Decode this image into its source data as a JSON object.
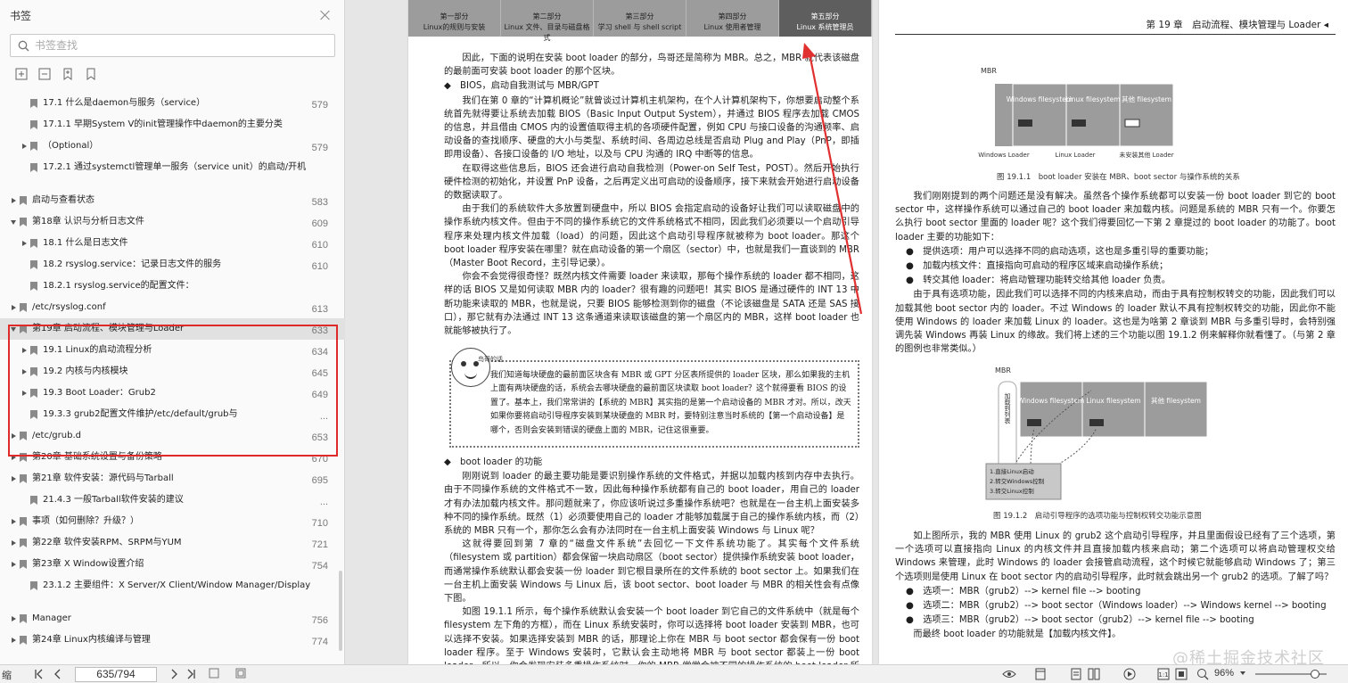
{
  "sidebar": {
    "title": "书签",
    "search_placeholder": "书签查找",
    "items": [
      {
        "label": "17.1 什么是daemon与服务（service）",
        "page": "579",
        "indent": 1,
        "chev": "none"
      },
      {
        "label": "17.1.1 早期System V的init管理操作中daemon的主要分类",
        "page": "",
        "indent": 1,
        "chev": "none"
      },
      {
        "label": "（Optional）",
        "page": "579",
        "indent": 1,
        "chev": "right"
      },
      {
        "label": "17.2.1 通过systemctl管理单一服务（service unit）的启动/开机",
        "page": "",
        "indent": 1,
        "chev": "none"
      },
      {
        "label": "启动与查看状态",
        "page": "583",
        "indent": 0,
        "chev": "right"
      },
      {
        "label": "第18章 认识与分析日志文件",
        "page": "609",
        "indent": 0,
        "chev": "down"
      },
      {
        "label": "18.1 什么是日志文件",
        "page": "610",
        "indent": 1,
        "chev": "right"
      },
      {
        "label": "18.2 rsyslog.service：记录日志文件的服务",
        "page": "610",
        "indent": 1,
        "chev": "none"
      },
      {
        "label": "18.2.1 rsyslog.service的配置文件：",
        "page": "",
        "indent": 1,
        "chev": "none"
      },
      {
        "label": "/etc/rsyslog.conf",
        "page": "613",
        "indent": 0,
        "chev": "right"
      },
      {
        "label": "第19章 启动流程、模块管理与Loader",
        "page": "633",
        "indent": 0,
        "chev": "down",
        "selected": true
      },
      {
        "label": "19.1 Linux的启动流程分析",
        "page": "634",
        "indent": 1,
        "chev": "right"
      },
      {
        "label": "19.2 内核与内核模块",
        "page": "645",
        "indent": 1,
        "chev": "right"
      },
      {
        "label": "19.3 Boot Loader：Grub2",
        "page": "649",
        "indent": 1,
        "chev": "right"
      },
      {
        "label": "19.3.3 grub2配置文件维护/etc/default/grub与",
        "page": "...",
        "indent": 1,
        "chev": "none"
      },
      {
        "label": "/etc/grub.d",
        "page": "653",
        "indent": 0,
        "chev": "right"
      },
      {
        "label": "第20章 基础系统设置与备份策略",
        "page": "670",
        "indent": 0,
        "chev": "right"
      },
      {
        "label": "第21章 软件安装：源代码与Tarball",
        "page": "695",
        "indent": 0,
        "chev": "right"
      },
      {
        "label": "21.4.3 一般Tarball软件安装的建议",
        "page": "...",
        "indent": 1,
        "chev": "none"
      },
      {
        "label": "事项（如何删除？升级？）",
        "page": "710",
        "indent": 0,
        "chev": "right"
      },
      {
        "label": "第22章 软件安装RPM、SRPM与YUM",
        "page": "721",
        "indent": 0,
        "chev": "right"
      },
      {
        "label": "第23章 X Window设置介绍",
        "page": "754",
        "indent": 0,
        "chev": "right"
      },
      {
        "label": "23.1.2 主要组件：X Server/X Client/Window Manager/Display",
        "page": "",
        "indent": 1,
        "chev": "none"
      },
      {
        "label": "Manager",
        "page": "756",
        "indent": 0,
        "chev": "right"
      },
      {
        "label": "第24章 Linux内核编译与管理",
        "page": "774",
        "indent": 0,
        "chev": "right"
      }
    ]
  },
  "left_page": {
    "tabs": [
      {
        "part": "第一部分",
        "name": "Linux的规则与安装"
      },
      {
        "part": "第二部分",
        "name": "Linux 文件、目录与磁盘格式"
      },
      {
        "part": "第三部分",
        "name": "学习 shell 与 shell script"
      },
      {
        "part": "第四部分",
        "name": "Linux 使用者管理"
      },
      {
        "part": "第五部分",
        "name": "Linux 系统管理员"
      }
    ],
    "p1": "因此，下面的说明在安装 boot loader 的部分，鸟哥还是简称为 MBR。总之，MBR 就代表该磁盘的最前面可安装 boot loader 的那个区块。",
    "h1": "◆　BIOS，启动自我测试与 MBR/GPT",
    "p2": "我们在第 0 章的“计算机概论”就曾谈过计算机主机架构，在个人计算机架构下，你想要启动整个系统首先就得要让系统去加载 BIOS（Basic Input Output System），并通过 BIOS 程序去加载 CMOS 的信息，并且借由 CMOS 内的设置值取得主机的各项硬件配置，例如 CPU 与接口设备的沟通频率、启动设备的查找顺序、硬盘的大小与类型、系统时间、各周边总线是否启动 Plug and Play（PnP，即插即用设备）、各接口设备的 I/O 地址，以及与 CPU 沟通的 IRQ 中断等的信息。",
    "p3": "在取得这些信息后，BIOS 还会进行启动自我检测（Power-on Self Test，POST）。然后开始执行硬件检测的初始化，并设置 PnP 设备，之后再定义出可启动的设备顺序，接下来就会开始进行启动设备的数据读取了。",
    "p4": "由于我们的系统软件大多放置到硬盘中，所以 BIOS 会指定启动的设备好让我们可以读取磁盘中的操作系统内核文件。但由于不同的操作系统它的文件系统格式不相同，因此我们必须要以一个启动引导程序来处理内核文件加载（load）的问题，因此这个启动引导程序就被称为 boot loader。那这个 boot loader 程序安装在哪里？就在启动设备的第一个扇区（sector）中，也就是我们一直谈到的 MBR（Master Boot Record，主引导记录）。",
    "p5": "你会不会觉得很奇怪？既然内核文件需要 loader 来读取，那每个操作系统的 loader 都不相同，这样的话 BIOS 又是如何读取 MBR 内的 loader？很有趣的问题吧！其实 BIOS 是通过硬件的 INT 13 中断功能来读取的 MBR，也就是说，只要 BIOS 能够检测到你的磁盘（不论该磁盘是 SATA 还是 SAS 接口），那它就有办法通过 INT 13 这条通道来读取该磁盘的第一个扇区内的 MBR，这样 boot loader 也就能够被执行了。",
    "note_tag": "鸟哥的话",
    "note": "我们知道每块硬盘的最前面区块含有 MBR 或 GPT 分区表所提供的 loader 区块，那么如果我的主机上面有两块硬盘的话，系统会去哪块硬盘的最前面区块读取 boot loader？这个就得要看 BIOS 的设置了。基本上，我们常常讲的【系统的 MBR】其实指的是第一个启动设备的 MBR 才对。所以，改天如果你要将启动引导程序安装到某块硬盘的 MBR 时，要特别注意当时系统的【第一个启动设备】是哪个，否则会安装到错误的硬盘上面的 MBR，记住这很重要。",
    "h2": "◆　boot loader 的功能",
    "p6": "刚刚说到 loader 的最主要功能是要识别操作系统的文件格式，并据以加载内核到内存中去执行。由于不同操作系统的文件格式不一致，因此每种操作系统都有自己的 boot loader，用自己的 loader 才有办法加载内核文件。那问题就来了，你应该听说过多重操作系统吧？也就是在一台主机上面安装多种不同的操作系统。既然（1）必须要使用自己的 loader 才能够加载属于自己的操作系统内核，而（2）系统的 MBR 只有一个，那你怎么会有办法同时在一台主机上面安装 Windows 与 Linux 呢？",
    "p7": "这就得要回到第 7 章的“磁盘文件系统”去回忆一下文件系统功能了。其实每个文件系统（filesystem 或 partition）都会保留一块启动扇区（boot sector）提供操作系统安装 boot loader，而通常操作系统默认都会安装一份 loader 到它根目录所在的文件系统的 boot sector 上。如果我们在一台主机上面安装 Windows 与 Linux 后，该 boot sector、boot loader 与 MBR 的相关性会有点像下图。",
    "p8": "如图 19.1.1 所示，每个操作系统默认会安装一个 boot loader 到它自己的文件系统中（就是每个 filesystem 左下角的方框），而在 Linux 系统安装时，你可以选择将 boot loader 安装到 MBR，也可以选择不安装。如果选择安装到 MBR 的话，那理论上你在 MBR 与 boot sector 都会保有一份 boot loader 程序。至于 Windows 安装时，它默认会主动地将 MBR 与 boot sector 都装上一份 boot loader。所以，你会发现安装多重操作系统时，你的 MBR 常常会被不同的操作系统的 boot loader 所覆盖。"
  },
  "right_page": {
    "header": "第 19 章　启动流程、模块管理与 Loader ◂",
    "fig1": {
      "mbr": "MBR",
      "parts": [
        "Windows filesystem",
        "Linux filesystem",
        "其他 filesystem"
      ],
      "loaders": [
        "Windows Loader",
        "Linux Loader",
        "未安装其他 Loader"
      ],
      "caption": "图 19.1.1　boot loader 安装在 MBR、boot sector 与操作系统的关系"
    },
    "p1": "我们刚刚提到的两个问题还是没有解决。虽然各个操作系统都可以安装一份 boot loader 到它的 boot sector 中，这样操作系统可以通过自己的 boot loader 来加载内核。问题是系统的 MBR 只有一个。你要怎么执行 boot sector 里面的 loader 呢？这个我们得要回忆一下第 2 章提过的 boot loader 的功能了。boot loader 主要的功能如下：",
    "b1": "●　提供选项：用户可以选择不同的启动选项，这也是多重引导的重要功能；",
    "b2": "●　加载内核文件：直接指向可启动的程序区域来启动操作系统；",
    "b3": "●　转交其他 loader：将启动管理功能转交给其他 loader 负责。",
    "p2": "由于具有选项功能，因此我们可以选择不同的内核来启动，而由于具有控制权转交的功能，因此我们可以加载其他 boot sector 内的 loader。不过 Windows 的 loader 默认不具有控制权转交的功能，因此你不能使用 Windows 的 loader 来加载 Linux 的 loader。这也是为啥第 2 章谈到 MBR 与多重引导时，会特别强调先装 Windows 再装 Linux 的缘故。我们将上述的三个功能以图 19.1.2 例来解释你就看懂了。（与第 2 章的图例也非常类似。）",
    "fig2": {
      "mbr": "MBR",
      "parts": [
        "Windows filesystem",
        "Linux filesystem",
        "其他 filesystem"
      ],
      "side": "加载到列表",
      "menu": [
        "1.直接Linux启动",
        "2.转交Windows控制",
        "3.转交Linux控制"
      ],
      "caption": "图 19.1.2　启动引导程序的选项功能与控制权转交功能示意图"
    },
    "p3": "如上图所示，我的 MBR 使用 Linux 的 grub2 这个启动引导程序，并且里面假设已经有了三个选项，第一个选项可以直接指向 Linux 的内核文件并且直接加载内核来启动；第二个选项可以将启动管理权交给 Windows 来管理，此时 Windows 的 loader 会接管启动流程，这个时候它就能够启动 Windows 了；第三个选项则是使用 Linux 在 boot sector 内的启动引导程序，此时就会跳出另一个 grub2 的选项。了解了吗？",
    "o1": "●　选项一：MBR（grub2）--> kernel file --> booting",
    "o2": "●　选项二：MBR（grub2）--> boot sector（Windows loader）--> Windows kernel --> booting",
    "o3": "●　选项三：MBR（grub2）--> boot sector（grub2）--> kernel file --> booting",
    "p4": "而最终 boot loader 的功能就是【加载内核文件】。"
  },
  "toolbar": {
    "left_label": "缩",
    "page_value": "635/794",
    "zoom": "96%"
  },
  "watermark": "@稀土掘金技术社区",
  "colors": {
    "highlight": "#e02a2a",
    "arrow": "#e03030",
    "tab_active": "#5e5e5e"
  }
}
